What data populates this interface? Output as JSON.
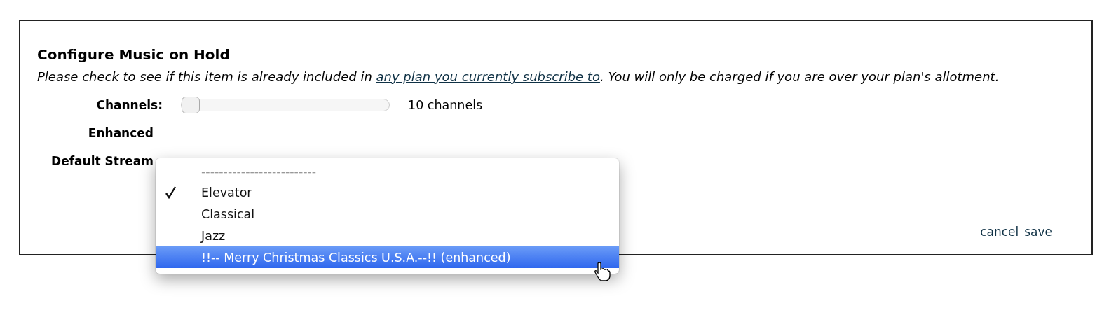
{
  "dialog": {
    "title": "Configure Music on Hold",
    "notice": {
      "before": "Please check to see if this item is already included in ",
      "link": "any plan you currently subscribe to",
      "after": ". You will only be charged if you are over your plan's allotment."
    },
    "channels": {
      "label": "Channels:",
      "level": 0,
      "reading": "10 channels"
    },
    "enhanced": {
      "label": "Enhanced"
    },
    "default_stream": {
      "label": "Default Stream"
    },
    "actions": [
      {
        "label": "cancel"
      },
      {
        "label": "save"
      }
    ]
  },
  "stream_menu": {
    "items": [
      {
        "kind": "separator",
        "label": "--------------------------",
        "highlighted": false
      },
      {
        "kind": "option",
        "label": "Elevator",
        "selected": true,
        "highlighted": false
      },
      {
        "kind": "option",
        "label": "Classical",
        "selected": false,
        "highlighted": false
      },
      {
        "kind": "option",
        "label": "Jazz",
        "selected": false,
        "highlighted": false
      },
      {
        "kind": "option",
        "label": "!!-- Merry Christmas Classics U.S.A.--!! (enhanced)",
        "selected": false,
        "highlighted": true
      }
    ]
  }
}
